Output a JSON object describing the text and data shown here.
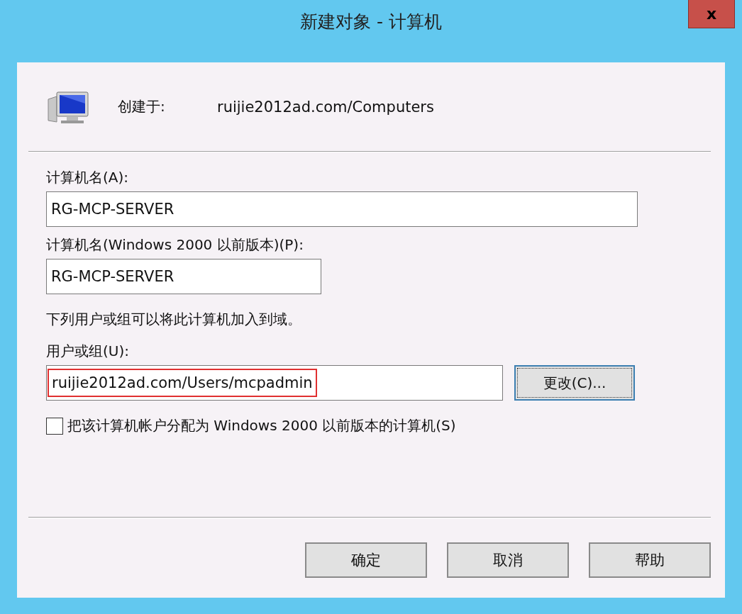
{
  "window": {
    "title": "新建对象 - 计算机",
    "close": "x"
  },
  "created_in": {
    "label": "创建于:",
    "value": "ruijie2012ad.com/Computers"
  },
  "fields": [
    {
      "label": "计算机名(A):",
      "value": "RG-MCP-SERVER"
    },
    {
      "label": "计算机名(Windows 2000 以前版本)(P):",
      "value": "RG-MCP-SERVER"
    }
  ],
  "join_note": "下列用户或组可以将此计算机加入到域。",
  "user_group": {
    "label": "用户或组(U):",
    "value": "ruijie2012ad.com/Users/mcpadmin",
    "highlighted": true,
    "change_button": "更改(C)..."
  },
  "legacy_checkbox": {
    "label": "把该计算机帐户分配为 Windows 2000 以前版本的计算机(S)",
    "checked": false
  },
  "buttons": [
    "确定",
    "取消",
    "帮助"
  ]
}
